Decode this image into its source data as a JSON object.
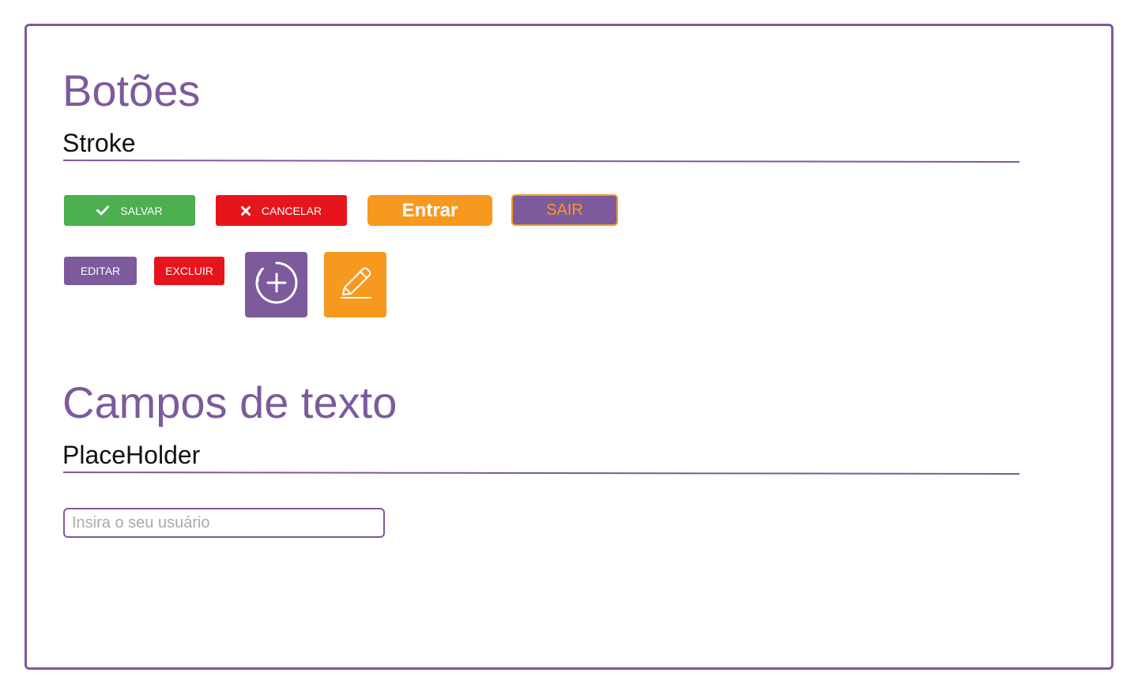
{
  "sections": {
    "buttons": {
      "title": "Botões",
      "subtitle": "Stroke"
    },
    "text_fields": {
      "title": "Campos de texto",
      "subtitle": "PlaceHolder"
    }
  },
  "buttons": {
    "save": {
      "label": "SALVAR",
      "icon": "check-icon"
    },
    "cancel": {
      "label": "CANCELAR",
      "icon": "close-icon"
    },
    "enter": {
      "label": "Entrar"
    },
    "exit": {
      "label": "SAIR"
    },
    "edit": {
      "label": "EDITAR"
    },
    "delete": {
      "label": "EXCLUIR"
    },
    "add_icon": {
      "icon": "add-circle-icon"
    },
    "edit_icon": {
      "icon": "pencil-icon"
    }
  },
  "inputs": {
    "username": {
      "placeholder": "Insira o seu usuário",
      "value": ""
    }
  },
  "colors": {
    "purple": "#7d5a9b",
    "orange": "#f7991e",
    "green": "#4caf50",
    "red": "#e8141c"
  }
}
